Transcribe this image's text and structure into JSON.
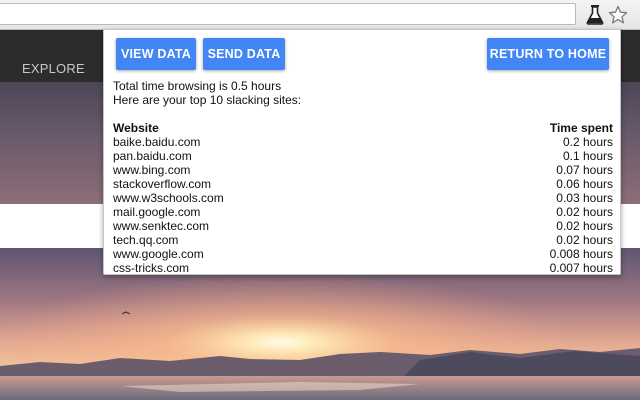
{
  "browser": {
    "extension_icon": "flask-icon",
    "bookmark_icon": "star-icon"
  },
  "site": {
    "nav": [
      "EXPLORE"
    ]
  },
  "popup": {
    "buttons": {
      "view_data": "VIEW DATA",
      "send_data": "SEND DATA",
      "return_home": "RETURN TO HOME"
    },
    "accent_color": "#4285f4",
    "total_text": "Total time browsing is 0.5 hours",
    "subtitle": "Here are your top 10 slacking sites:",
    "table": {
      "headers": [
        "Website",
        "Time spent"
      ],
      "rows": [
        [
          "baike.baidu.com",
          "0.2 hours"
        ],
        [
          "pan.baidu.com",
          "0.1 hours"
        ],
        [
          "www.bing.com",
          "0.07 hours"
        ],
        [
          "stackoverflow.com",
          "0.06 hours"
        ],
        [
          "www.w3schools.com",
          "0.03 hours"
        ],
        [
          "mail.google.com",
          "0.02 hours"
        ],
        [
          "www.senktec.com",
          "0.02 hours"
        ],
        [
          "tech.qq.com",
          "0.02 hours"
        ],
        [
          "www.google.com",
          "0.008 hours"
        ],
        [
          "css-tricks.com",
          "0.007 hours"
        ]
      ]
    }
  }
}
